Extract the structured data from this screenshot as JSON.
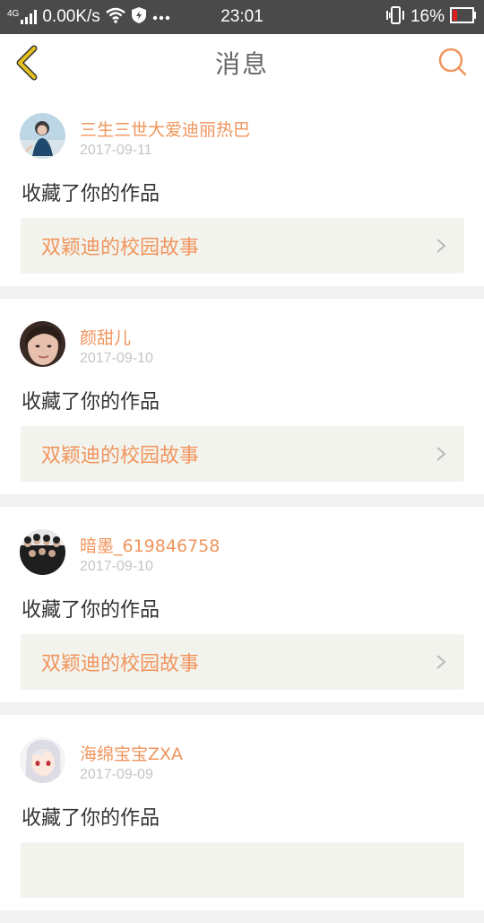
{
  "status_bar": {
    "network_type": "4G",
    "speed": "0.00K/s",
    "time": "23:01",
    "battery": "16%"
  },
  "header": {
    "title": "消息"
  },
  "colors": {
    "accent": "#f0955c",
    "back_arrow": "#e8c21a"
  },
  "messages": [
    {
      "user": "三生三世大爱迪丽热巴",
      "date": "2017-09-11",
      "action": "收藏了你的作品",
      "work_title": "双颖迪的校园故事"
    },
    {
      "user": "颜甜儿",
      "date": "2017-09-10",
      "action": "收藏了你的作品",
      "work_title": "双颖迪的校园故事"
    },
    {
      "user": "暗墨_619846758",
      "date": "2017-09-10",
      "action": "收藏了你的作品",
      "work_title": "双颖迪的校园故事"
    },
    {
      "user": "海绵宝宝ZXA",
      "date": "2017-09-09",
      "action": "收藏了你的作品",
      "work_title": ""
    }
  ]
}
